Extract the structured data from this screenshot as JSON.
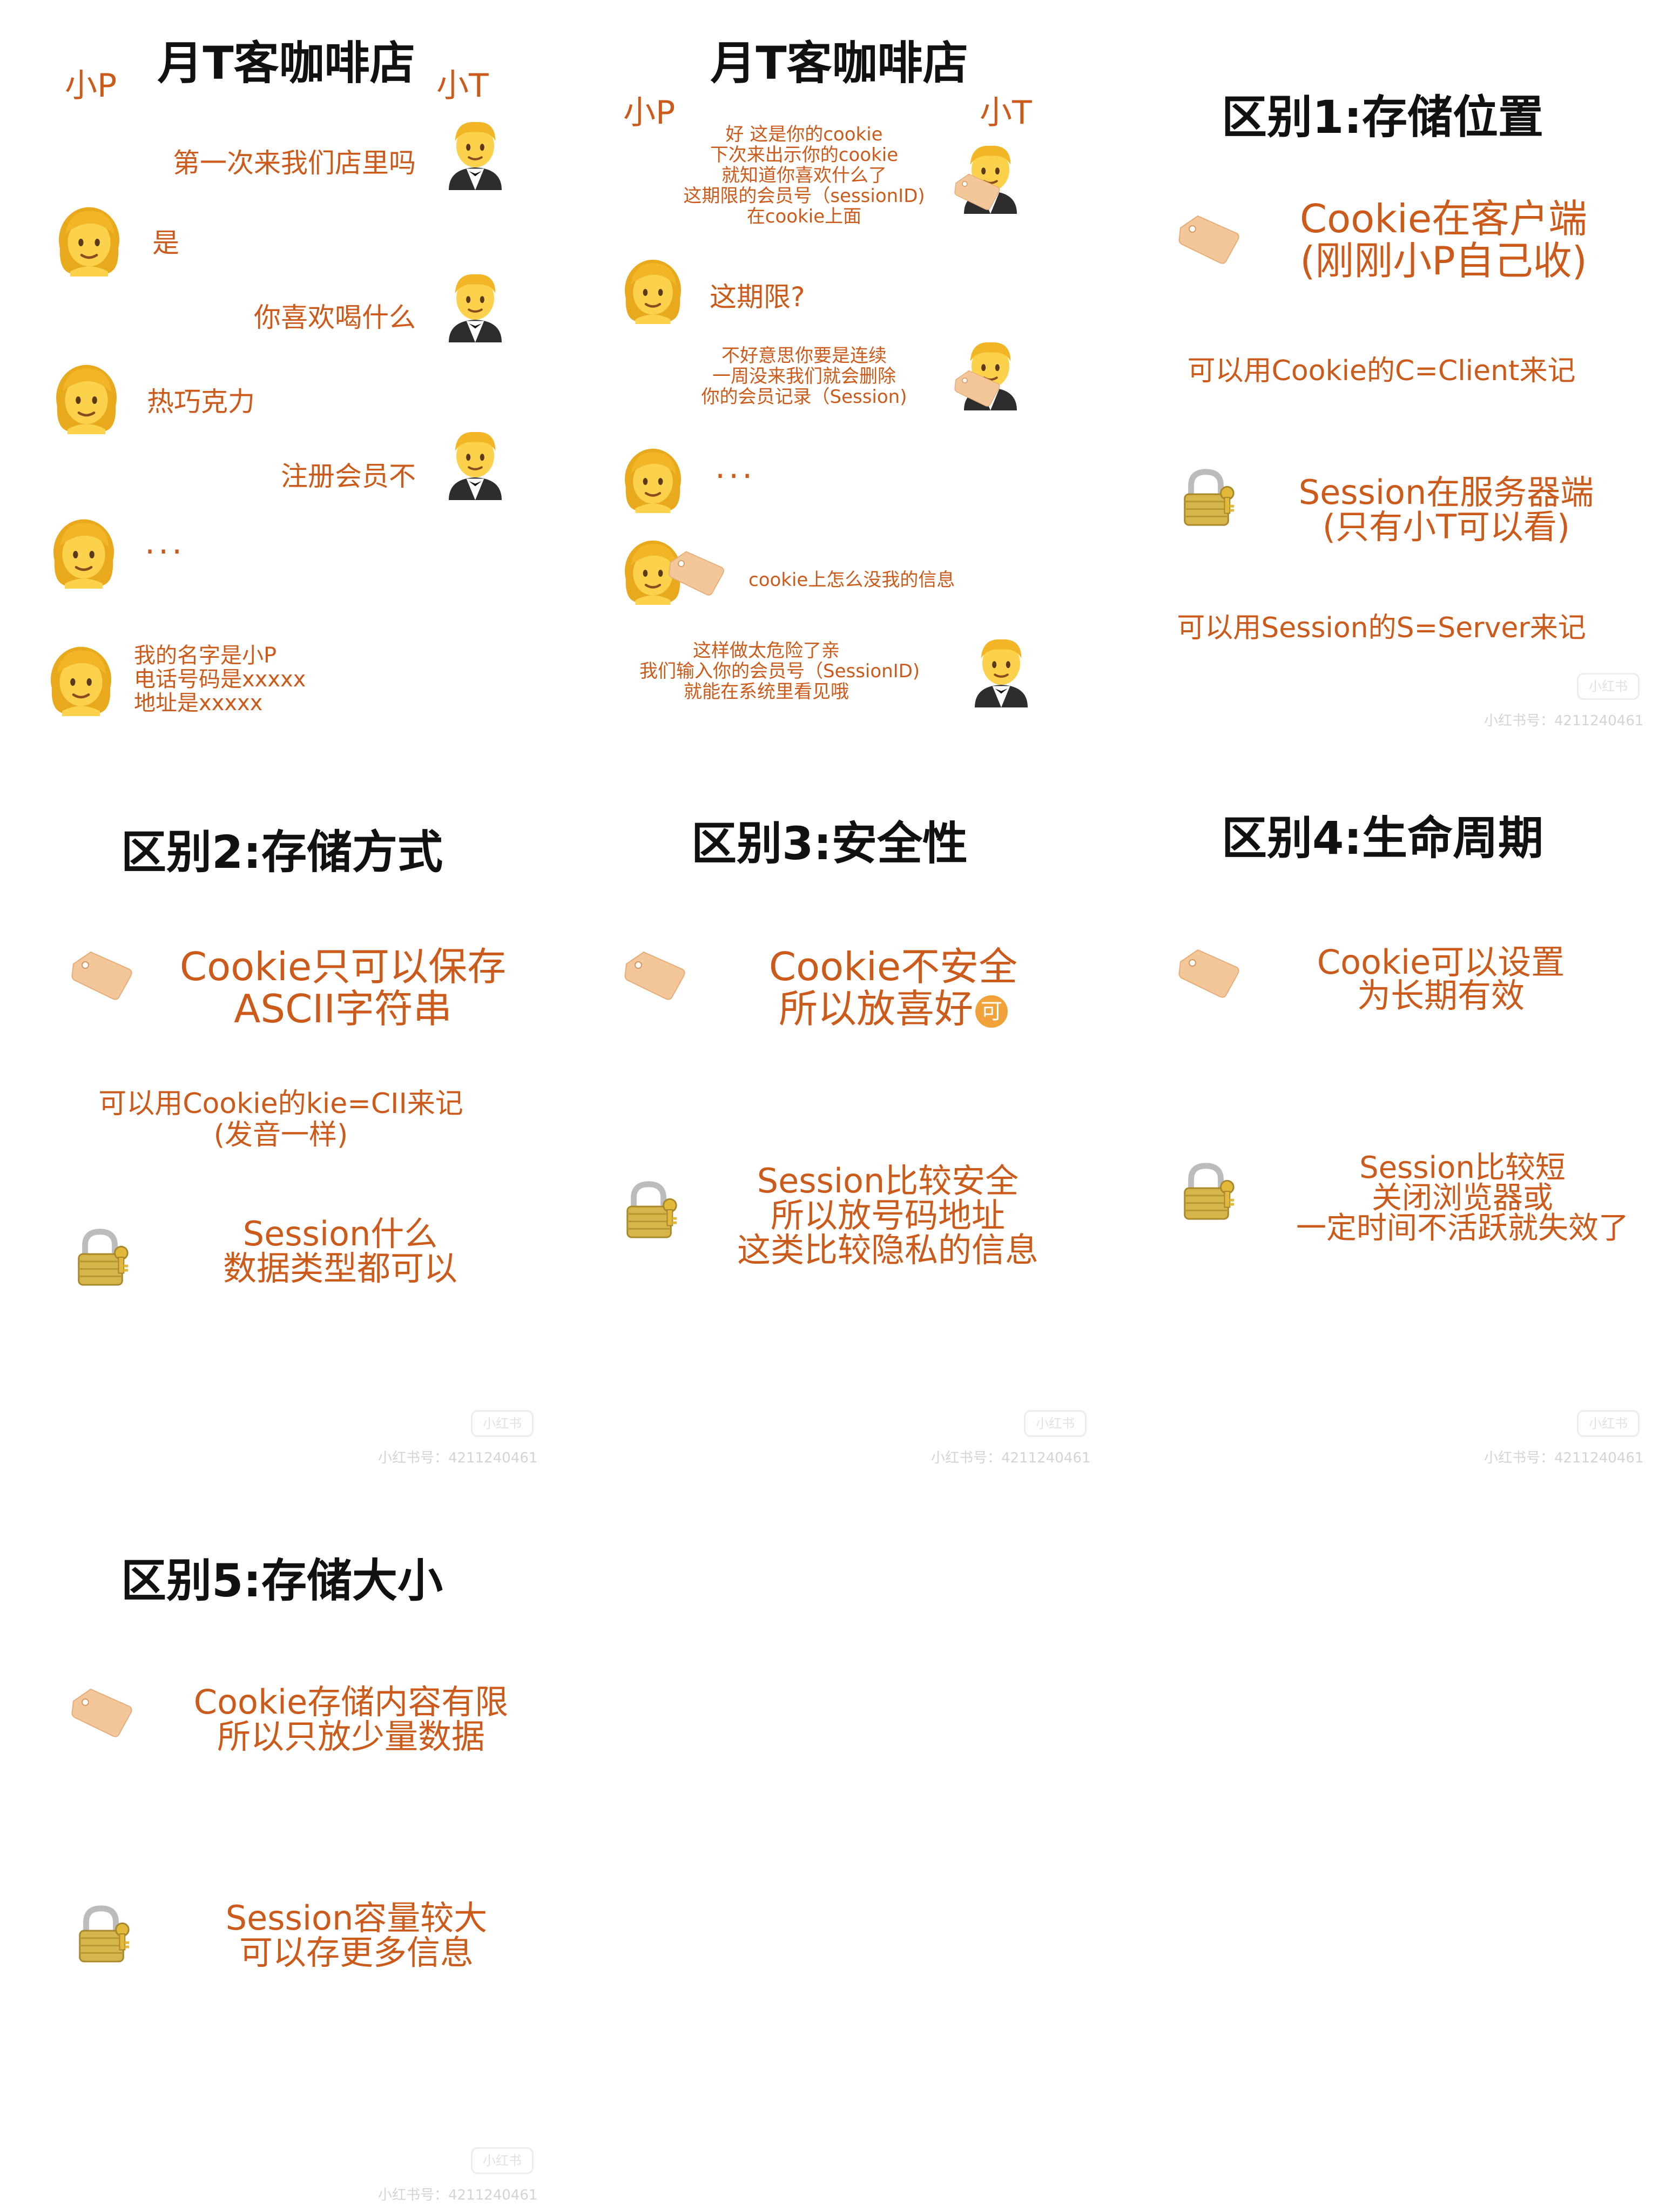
{
  "panel1": {
    "title": "月T客咖啡店",
    "left_name": "小P",
    "right_name": "小T",
    "msg1": "第一次来我们店里吗",
    "msg2": "是",
    "msg3": "你喜欢喝什么",
    "msg4": "热巧克力",
    "msg5": "注册会员不",
    "msg6": "...",
    "msg7_lines": [
      "我的名字是小P",
      "电话号码是xxxxx",
      "地址是xxxxx"
    ]
  },
  "panel2": {
    "title": "月T客咖啡店",
    "left_name": "小P",
    "right_name": "小T",
    "msg1_lines": [
      "好 这是你的cookie",
      "下次来出示你的cookie",
      "就知道你喜欢什么了",
      "这期限的会员号（sessionID)",
      "在cookie上面"
    ],
    "msg2": "这期限?",
    "msg3_lines": [
      "不好意思你要是连续",
      "一周没来我们就会删除",
      "你的会员记录（Session)"
    ],
    "msg4": "...",
    "msg5": "cookie上怎么没我的信息",
    "msg6_lines": [
      "这样做太危险了亲",
      "我们输入你的会员号（SessionID)",
      "就能在系统里看见哦"
    ]
  },
  "panel3": {
    "title": "区别1:存储位置",
    "cookie_lines": [
      "Cookie在客户端",
      "(刚刚小P自己收)"
    ],
    "cookie_note": "可以用Cookie的C=Client来记",
    "session_lines": [
      "Session在服务器端",
      "(只有小T可以看)"
    ],
    "session_note": "可以用Session的S=Server来记",
    "watermark": "小红书号：4211240461",
    "wm_badge": "小红书"
  },
  "panel4": {
    "title": "区别2:存储方式",
    "cookie_lines": [
      "Cookie只可以保存",
      "ASCII字符串"
    ],
    "cookie_note_lines": [
      "可以用Cookie的kie=CII来记",
      "(发音一样)"
    ],
    "session_lines": [
      "Session什么",
      "数据类型都可以"
    ],
    "watermark": "小红书号：4211240461",
    "wm_badge": "小红书"
  },
  "panel5": {
    "title": "区别3:安全性",
    "cookie_lines": [
      "Cookie不安全",
      "所以放喜好"
    ],
    "session_lines": [
      "Session比较安全",
      "所以放号码地址",
      "这类比较隐私的信息"
    ],
    "watermark": "小红书号：4211240461",
    "wm_badge": "小红书",
    "badge_char": "可"
  },
  "panel6": {
    "title": "区别4:生命周期",
    "cookie_lines": [
      "Cookie可以设置",
      "为长期有效"
    ],
    "session_lines": [
      "Session比较短",
      "关闭浏览器或",
      "一定时间不活跃就失效了"
    ],
    "watermark": "小红书号：4211240461",
    "wm_badge": "小红书"
  },
  "panel7": {
    "title": "区别5:存储大小",
    "cookie_lines": [
      "Cookie存储内容有限",
      "所以只放少量数据"
    ],
    "session_lines": [
      "Session容量较大",
      "可以存更多信息"
    ],
    "watermark": "小红书号：4211240461",
    "wm_badge": "小红书"
  },
  "icons": {
    "woman": "woman-emoji-icon",
    "man": "man-in-tuxedo-icon",
    "tag": "label-tag-icon",
    "lock": "lock-with-key-icon"
  },
  "colors": {
    "text_orange": "#cc5a1a",
    "title_black": "#111111",
    "tag_fill": "#f4c79a",
    "hair_yellow": "#f7c22a",
    "skin": "#fbd26a",
    "lock_gold": "#d6b54a"
  }
}
